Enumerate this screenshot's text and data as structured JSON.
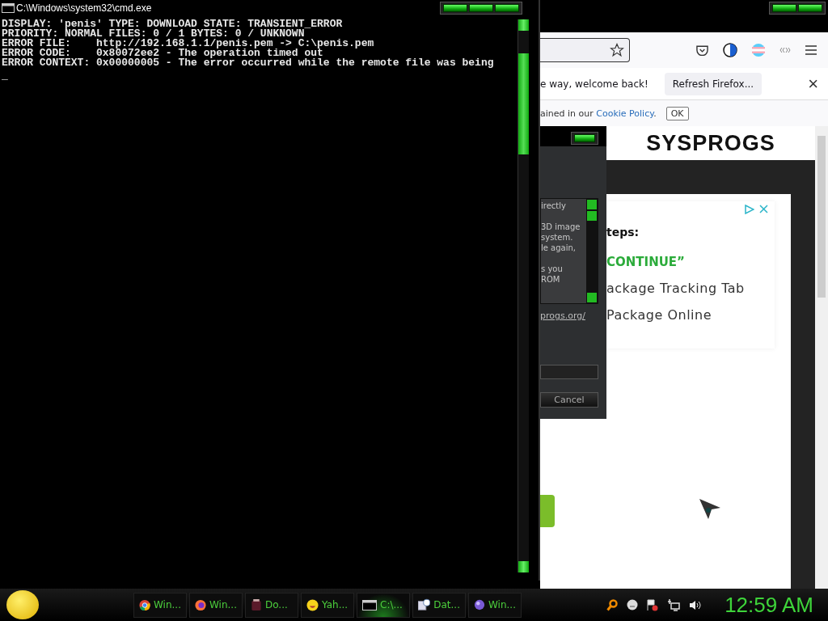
{
  "console_window": {
    "title": "C:\\Windows\\system32\\cmd.exe",
    "lines": [
      "DISPLAY: 'penis' TYPE: DOWNLOAD STATE: TRANSIENT_ERROR",
      "PRIORITY: NORMAL FILES: 0 / 1 BYTES: 0 / UNKNOWN",
      "ERROR FILE:    http://192.168.1.1/penis.pem -> C:\\penis.pem",
      "ERROR CODE:    0x80072ee2 - The operation timed out",
      "ERROR CONTEXT: 0x00000005 - The error occurred while the remote file was being"
    ],
    "cursor": "_"
  },
  "browser": {
    "notification": {
      "message": "e way, welcome back!",
      "button": "Refresh Firefox...",
      "close": "×"
    },
    "cookie_bar": {
      "text_before": "ained in our ",
      "link": "Cookie Policy",
      "text_after": ".",
      "button": "OK"
    },
    "page": {
      "logo": "SYSPROGS",
      "ad_heading": "teps:",
      "ad_cta": "CONTINUE”",
      "ad_lines": [
        "ackage Tracking Tab",
        "Package Online"
      ]
    }
  },
  "dialog": {
    "paragraphs": [
      "irectly",
      "3D image\nsystem.\nle again,",
      "s you\nROM"
    ],
    "link": "progs.org/",
    "cancel_button": "Cancel"
  },
  "taskbar": {
    "items": [
      {
        "label": "Win...",
        "selected": false
      },
      {
        "label": "Win...",
        "selected": false
      },
      {
        "label": "Do...",
        "selected": false
      },
      {
        "label": "Yah...",
        "selected": false
      },
      {
        "label": "C:\\...",
        "selected": true
      },
      {
        "label": "Dat...",
        "selected": false
      },
      {
        "label": "Win...",
        "selected": false
      }
    ],
    "clock": "12:59 AM"
  }
}
